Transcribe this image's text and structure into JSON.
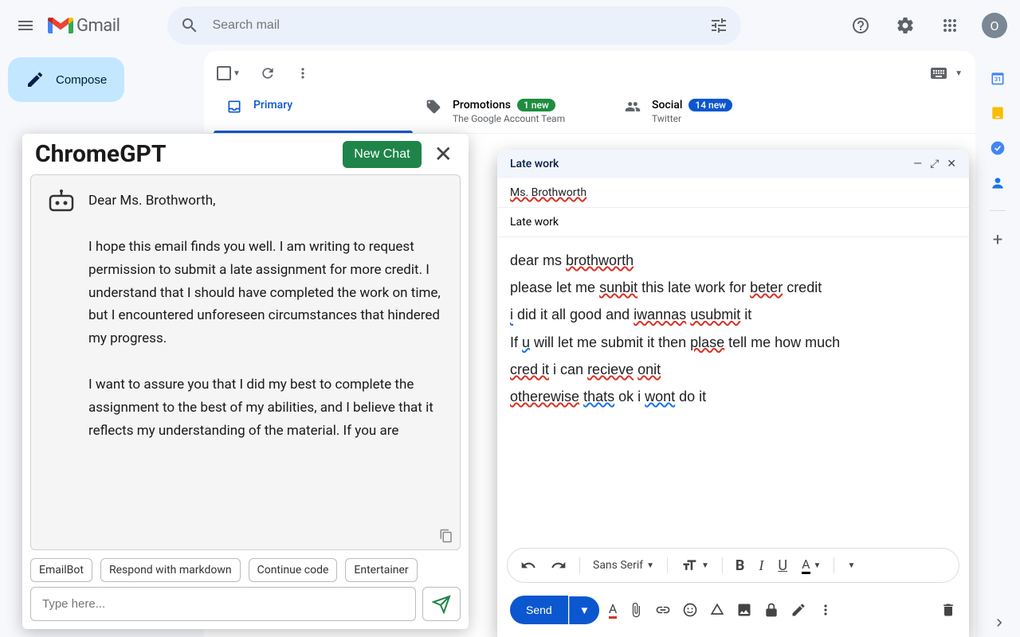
{
  "header": {
    "brand": "Gmail",
    "search_placeholder": "Search mail",
    "avatar_initial": "O"
  },
  "compose_button": "Compose",
  "toolbar": {},
  "tabs": {
    "primary": "Primary",
    "promotions": {
      "label": "Promotions",
      "badge": "1 new",
      "sub": "The Google Account Team"
    },
    "social": {
      "label": "Social",
      "badge": "14 new",
      "sub": "Twitter"
    }
  },
  "compose": {
    "window_title": "Late work",
    "to": "Ms. Brothworth",
    "subject": "Late work",
    "body_lines": [
      {
        "pre": "dear ms ",
        "err": "brothworth",
        "type": "spell",
        "post": ""
      },
      {
        "pre": "please let me ",
        "err": "sunbit",
        "type": "spell",
        "mid": " this late work for ",
        "err2": "beter",
        "type2": "spell",
        "post": " credit"
      },
      {
        "pre": "",
        "err": "i",
        "type": "grammar",
        "mid": " did it all good and ",
        "err2": "iwannas",
        "type2": "spell",
        "mid2": " ",
        "err3": "usubmit",
        "type3": "spell",
        "post": " it"
      },
      {
        "pre": "If ",
        "err": "u",
        "type": "grammar",
        "mid": " will let me submit it then ",
        "err2": "plase",
        "type2": "spell",
        "post": " tell me how much"
      },
      {
        "pre": "",
        "err": "cred it",
        "type": "spell",
        "mid": " i can ",
        "err2": "recieve",
        "type2": "spell",
        "mid2": " ",
        "err3": "onit",
        "type3": "spell",
        "post": ""
      },
      {
        "pre": "",
        "err": "otherewise",
        "type": "spell",
        "mid": " ",
        "err2": "thats",
        "type2": "grammar",
        "mid2": " ok i ",
        "err3": "wont",
        "type3": "grammar",
        "post": " do it"
      }
    ],
    "font_name": "Sans Serif",
    "send_label": "Send"
  },
  "gpt": {
    "title": "ChromeGPT",
    "new_chat": "New Chat",
    "message": "Dear Ms. Brothworth,\n\nI hope this email finds you well. I am writing to request permission to submit a late assignment for more credit. I understand that I should have completed the work on time, but I encountered unforeseen circumstances that hindered my progress.\n\nI want to assure you that I did my best to complete the assignment to the best of my abilities, and I believe that it reflects my understanding of the material. If you are",
    "chips": [
      "EmailBot",
      "Respond with markdown",
      "Continue code",
      "Entertainer"
    ],
    "input_placeholder": "Type here..."
  }
}
